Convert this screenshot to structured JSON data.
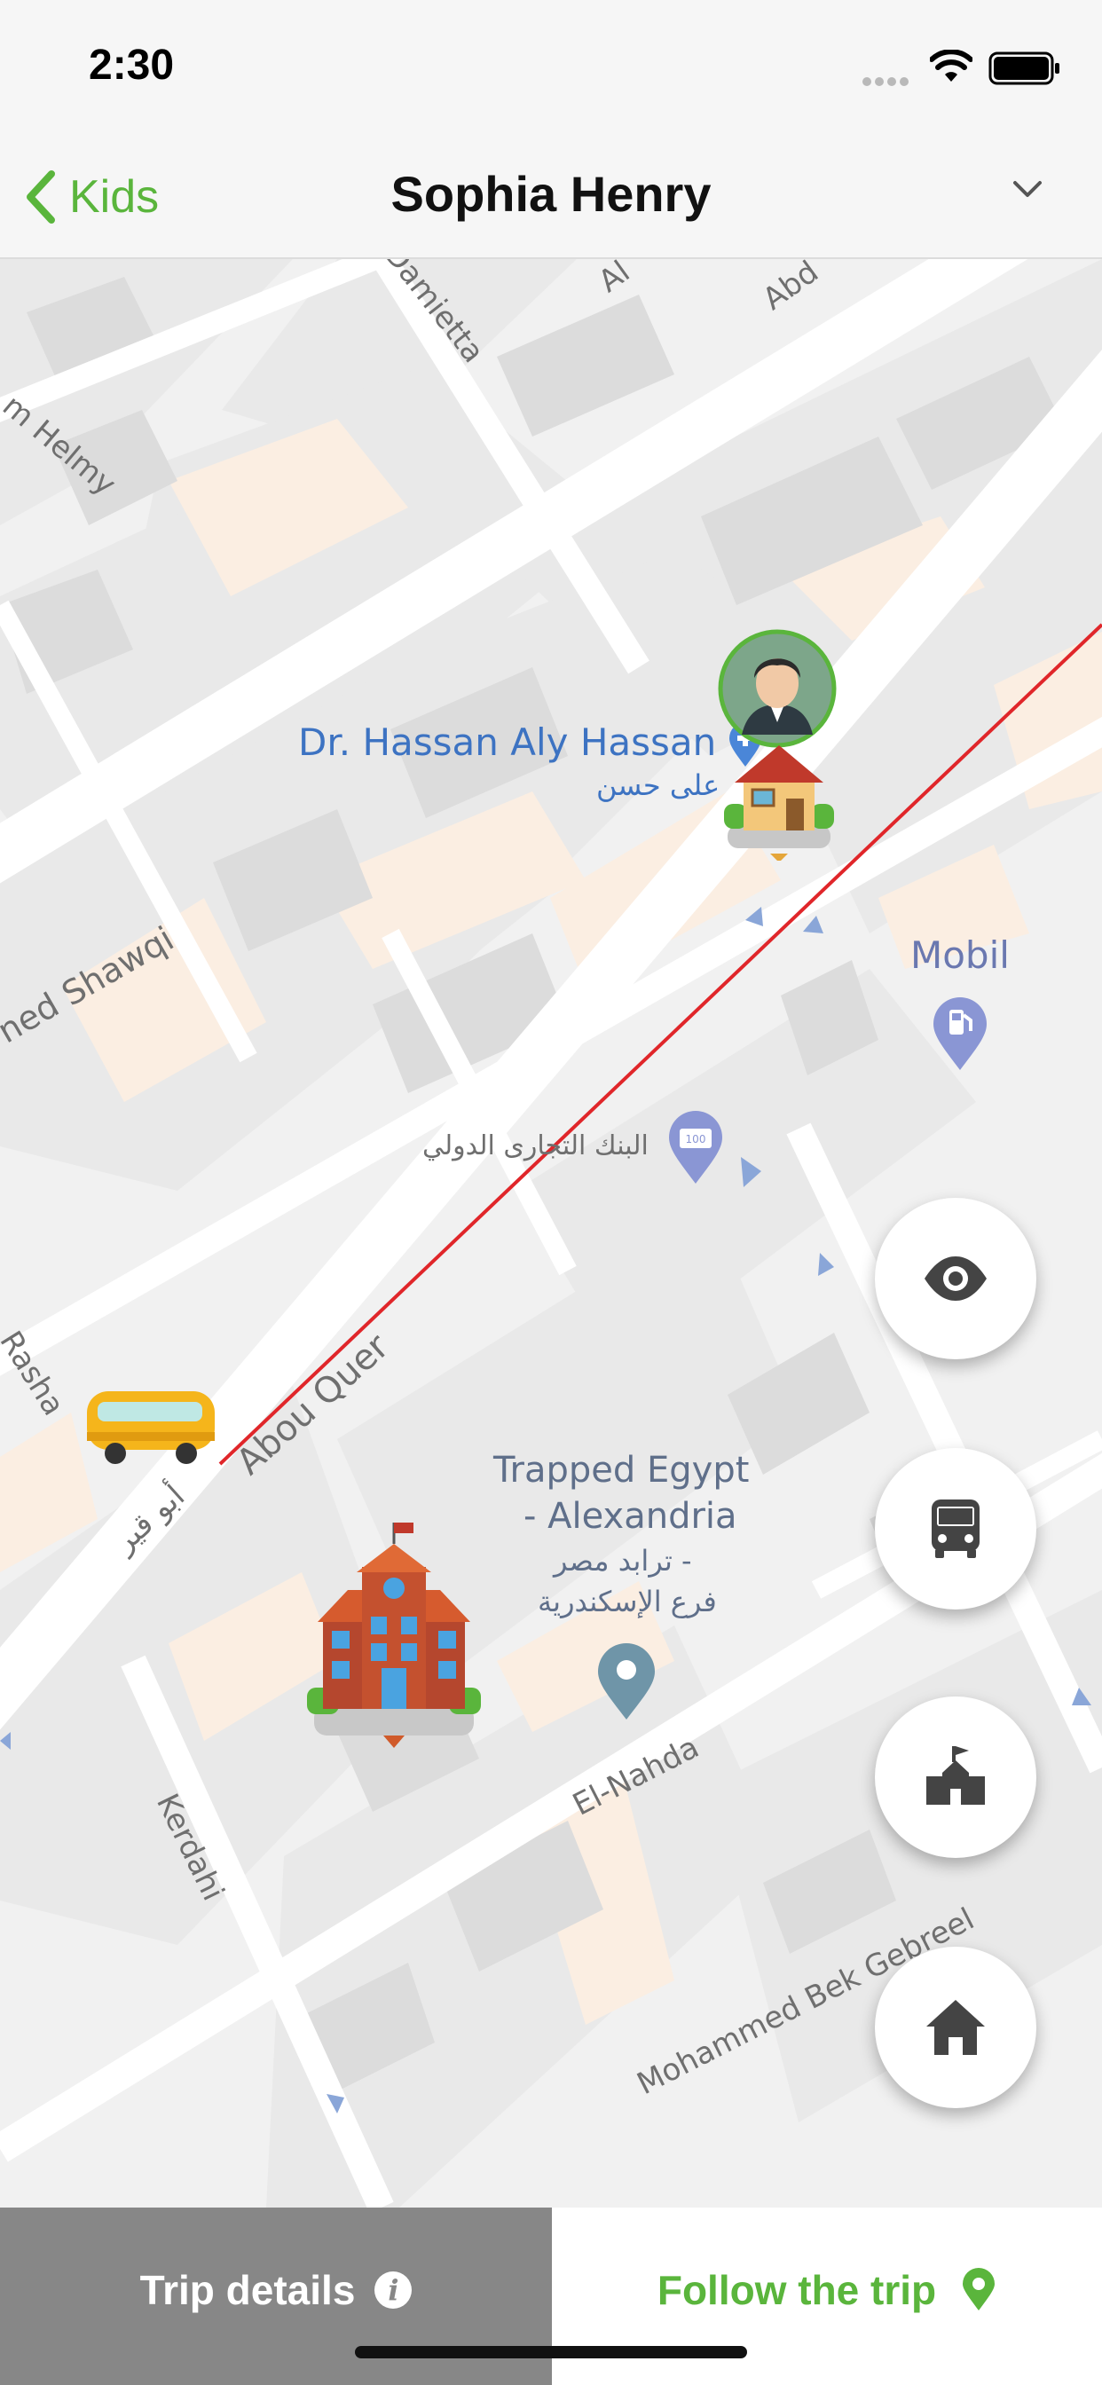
{
  "status_bar": {
    "time": "2:30"
  },
  "nav": {
    "back_label": "Kids",
    "title": "Sophia Henry"
  },
  "map": {
    "streets": {
      "damietta": "Damietta",
      "helmy": "m Helmy",
      "abd": "Abd",
      "al": "Al",
      "shawqi": "ned Shawqi",
      "abou_quer": "Abou Quer",
      "abou_quer_ar": "أبو قير",
      "rasha": "Rasha",
      "el_nahda": "El-Nahda",
      "kerdahi": "Kerdahi",
      "mohammed_bek": "Mohammed Bek Gebreel"
    },
    "pois": {
      "hassan_en": "Dr. Hassan Aly Hassan",
      "hassan_ar": "على حسن",
      "mobil": "Mobil",
      "bank_ar": "البنك التجارى الدولي",
      "trapped_line1": "Trapped Egypt",
      "trapped_line2": "- Alexandria",
      "trapped_ar1": "ترابد مصر -",
      "trapped_ar2": "فرع الإسكندرية"
    },
    "route_color": "#e0262a"
  },
  "fab_icons": [
    "eye-icon",
    "bus-icon",
    "school-icon",
    "home-icon"
  ],
  "bottom_bar": {
    "trip_details_label": "Trip details",
    "follow_trip_label": "Follow the trip",
    "info_glyph": "i"
  },
  "colors": {
    "accent": "#5ab53c",
    "trip_details_bg": "#878787"
  }
}
